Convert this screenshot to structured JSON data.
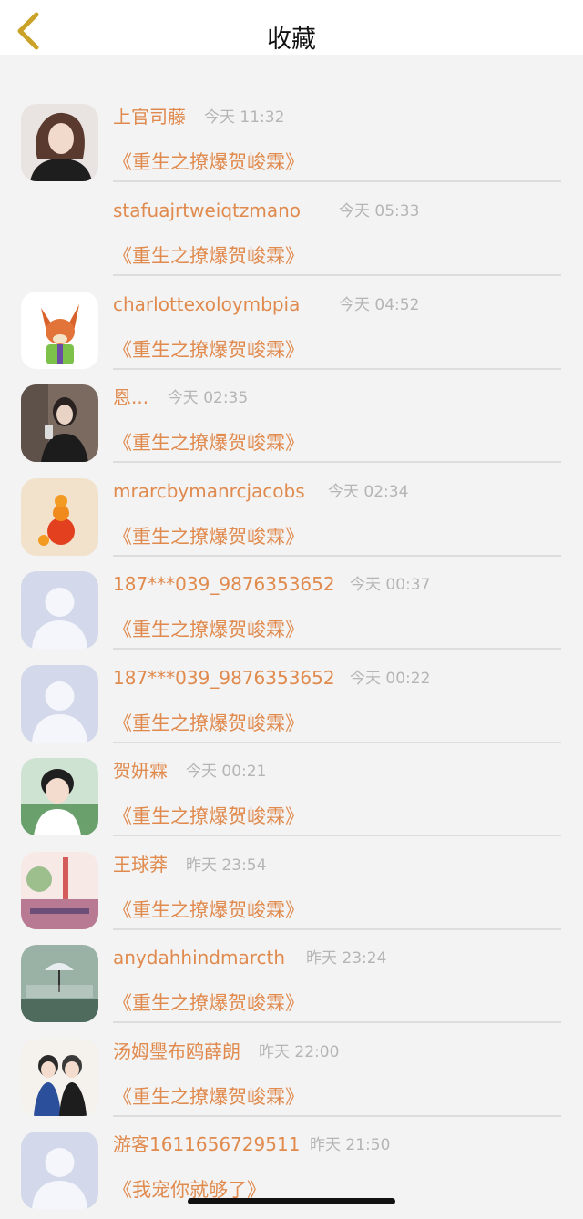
{
  "header": {
    "title": "收藏"
  },
  "colors": {
    "accent": "#e08a4e",
    "time": "#b5b5b5",
    "background": "#f3f3f3"
  },
  "items": [
    {
      "avatar": "default-avatar",
      "name": "",
      "time": "",
      "book": "《重生之撩爆贺峻霖》"
    },
    {
      "avatar": "photo-avatar-girl",
      "name": "上官司藤",
      "time": "今天 11:32",
      "book": "《重生之撩爆贺峻霖》"
    },
    {
      "avatar": "",
      "name": "stafuajrtweiqtzmano",
      "time": "今天 05:33",
      "book": "《重生之撩爆贺峻霖》"
    },
    {
      "avatar": "fox-cartoon-avatar",
      "name": "charlottexoloymbpia",
      "time": "今天 04:52",
      "book": "《重生之撩爆贺峻霖》"
    },
    {
      "avatar": "mirror-selfie-avatar",
      "name": "恩...",
      "time": "今天 02:35",
      "book": "《重生之撩爆贺峻霖》"
    },
    {
      "avatar": "orange-fruit-avatar",
      "name": "mrarcbymanrcjacobs",
      "time": "今天 02:34",
      "book": "《重生之撩爆贺峻霖》"
    },
    {
      "avatar": "default-avatar",
      "name": "187***039_9876353652",
      "time": "今天 00:37",
      "book": "《重生之撩爆贺峻霖》"
    },
    {
      "avatar": "default-avatar",
      "name": "187***039_9876353652",
      "time": "今天 00:22",
      "book": "《重生之撩爆贺峻霖》"
    },
    {
      "avatar": "boy-portrait-avatar",
      "name": "贺妍霖",
      "time": "今天 00:21",
      "book": "《重生之撩爆贺峻霖》"
    },
    {
      "avatar": "pink-scene-avatar",
      "name": "王球莽",
      "time": "昨天 23:54",
      "book": "《重生之撩爆贺峻霖》"
    },
    {
      "avatar": "umbrella-scene-avatar",
      "name": "anydahhindmarcth",
      "time": "昨天 23:24",
      "book": "《重生之撩爆贺峻霖》"
    },
    {
      "avatar": "two-boys-avatar",
      "name": "汤姆璺布鸥薛朗",
      "time": "昨天 22:00",
      "book": "《重生之撩爆贺峻霖》"
    },
    {
      "avatar": "default-avatar",
      "name": "游客1611656729511",
      "time": "昨天 21:50",
      "book": "《我宠你就够了》"
    }
  ]
}
